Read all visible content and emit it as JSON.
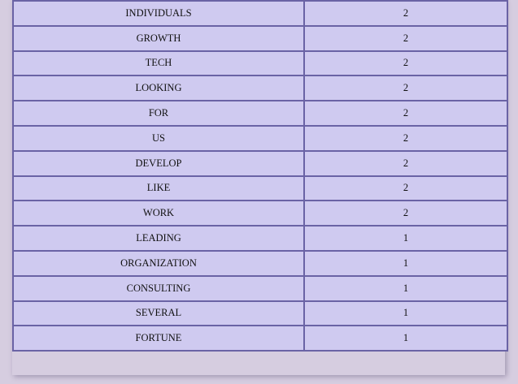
{
  "word_frequency_table": {
    "rows": [
      {
        "word": "INDIVIDUALS",
        "count": "2"
      },
      {
        "word": "GROWTH",
        "count": "2"
      },
      {
        "word": "TECH",
        "count": "2"
      },
      {
        "word": "LOOKING",
        "count": "2"
      },
      {
        "word": "FOR",
        "count": "2"
      },
      {
        "word": "US",
        "count": "2"
      },
      {
        "word": "DEVELOP",
        "count": "2"
      },
      {
        "word": "LIKE",
        "count": "2"
      },
      {
        "word": "WORK",
        "count": "2"
      },
      {
        "word": "LEADING",
        "count": "1"
      },
      {
        "word": "ORGANIZATION",
        "count": "1"
      },
      {
        "word": "CONSULTING",
        "count": "1"
      },
      {
        "word": "SEVERAL",
        "count": "1"
      },
      {
        "word": "FORTUNE",
        "count": "1"
      }
    ]
  },
  "colors": {
    "page_background": "#d6cde0",
    "cell_background": "#cfcaf0",
    "cell_border": "#6a63a5",
    "text": "#111111"
  }
}
